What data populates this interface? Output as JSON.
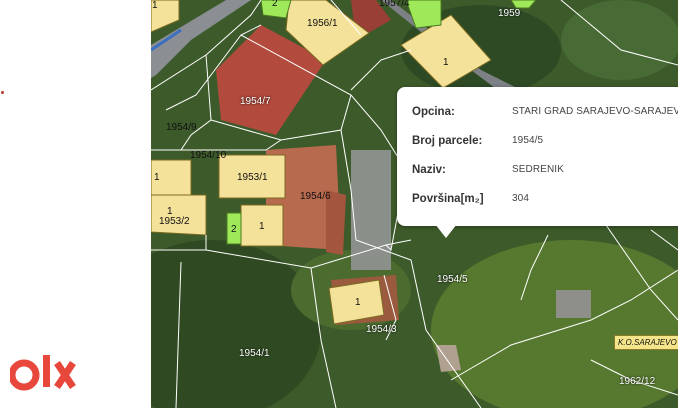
{
  "popup": {
    "rows": [
      {
        "key": "Opcina:",
        "value": "STARI GRAD SARAJEVO-SARAJEVO XII"
      },
      {
        "key": "Broj parcele:",
        "value": "1954/5"
      },
      {
        "key": "Naziv:",
        "value": "SEDRENIK"
      },
      {
        "key": "Površina[m₂]",
        "value": "304"
      }
    ]
  },
  "map_labels": {
    "p1954_9": "1954/9",
    "p1954_10": "1954/10",
    "p1954_7": "1954/7",
    "p1956_1": "1956/1",
    "p1957_4": "1957/4",
    "p1959": "1959",
    "p1953_1": "1953/1",
    "p1953_2": "1953/2",
    "p1954_6": "1954/6",
    "p1954_5": "1954/5",
    "p1954_3": "1954/3",
    "p1954_1": "1954/1",
    "p1962_12": "1962/12",
    "b1": "1",
    "b2": "2",
    "ko": "K.O.SARAJEVO"
  },
  "colors": {
    "building_yellow": "#f5e29a",
    "building_green": "#9ee85a",
    "parcel_line": "#ffffff",
    "logo_red": "#e8473b"
  },
  "logo": {
    "brand": "olx"
  }
}
